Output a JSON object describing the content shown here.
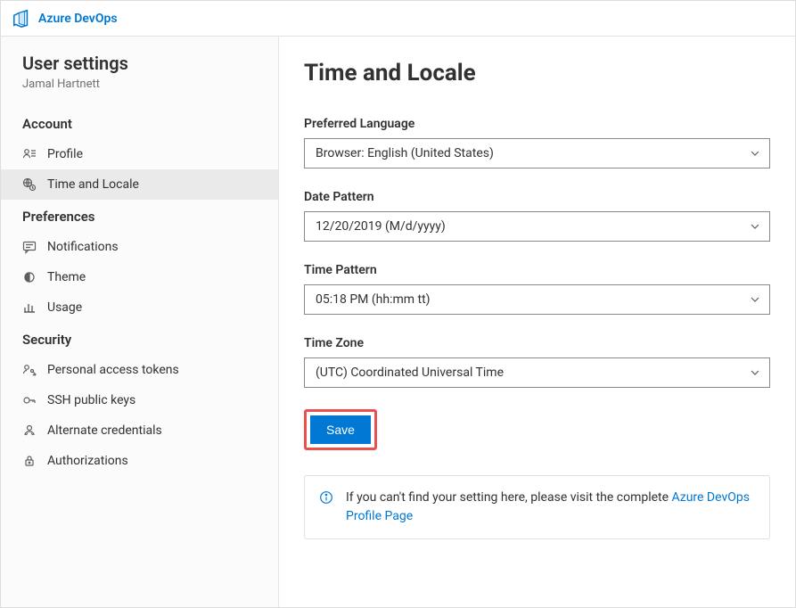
{
  "header": {
    "brand": "Azure DevOps"
  },
  "sidebar": {
    "title": "User settings",
    "user": "Jamal Hartnett",
    "sections": {
      "account": {
        "header": "Account",
        "items": [
          {
            "label": "Profile"
          },
          {
            "label": "Time and Locale"
          }
        ]
      },
      "preferences": {
        "header": "Preferences",
        "items": [
          {
            "label": "Notifications"
          },
          {
            "label": "Theme"
          },
          {
            "label": "Usage"
          }
        ]
      },
      "security": {
        "header": "Security",
        "items": [
          {
            "label": "Personal access tokens"
          },
          {
            "label": "SSH public keys"
          },
          {
            "label": "Alternate credentials"
          },
          {
            "label": "Authorizations"
          }
        ]
      }
    }
  },
  "page": {
    "title": "Time and Locale",
    "fields": {
      "language": {
        "label": "Preferred Language",
        "value": "Browser: English (United States)"
      },
      "datePattern": {
        "label": "Date Pattern",
        "value": "12/20/2019 (M/d/yyyy)"
      },
      "timePattern": {
        "label": "Time Pattern",
        "value": "05:18 PM (hh:mm tt)"
      },
      "timeZone": {
        "label": "Time Zone",
        "value": "(UTC) Coordinated Universal Time"
      }
    },
    "saveLabel": "Save",
    "info": {
      "textBefore": "If you can't find your setting here, please visit the complete ",
      "linkText": "Azure DevOps Profile Page"
    }
  }
}
